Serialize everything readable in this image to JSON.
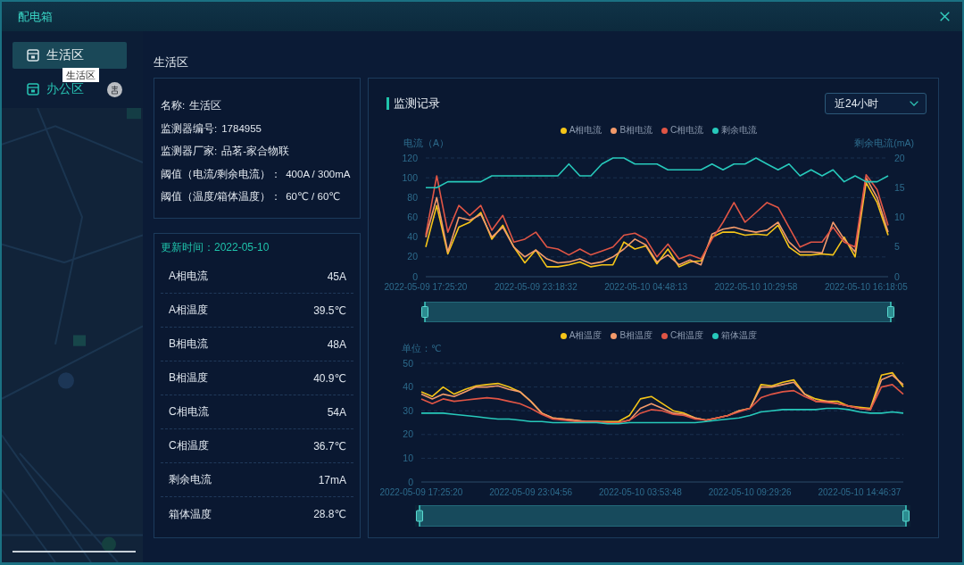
{
  "window": {
    "title": "配电箱"
  },
  "sidebar": {
    "items": [
      {
        "label": "生活区",
        "selected": true,
        "badge": false
      },
      {
        "label": "办公区",
        "selected": false,
        "badge": true
      }
    ],
    "tooltip": "生活区"
  },
  "heading": "生活区",
  "info": [
    {
      "label": "名称:",
      "value": "生活区"
    },
    {
      "label": "监测器编号:",
      "value": "1784955"
    },
    {
      "label": "监测器厂家:",
      "value": "品茗-家合物联"
    },
    {
      "label": "阈值（电流/剩余电流）：",
      "value": "400A / 300mA"
    },
    {
      "label": "阈值（温度/箱体温度）：",
      "value": "60℃ / 60℃"
    }
  ],
  "readings": {
    "updated": "更新时间：2022-05-10",
    "rows": [
      {
        "label": "A相电流",
        "value": "45A"
      },
      {
        "label": "A相温度",
        "value": "39.5℃"
      },
      {
        "label": "B相电流",
        "value": "48A"
      },
      {
        "label": "B相温度",
        "value": "40.9℃"
      },
      {
        "label": "C相电流",
        "value": "54A"
      },
      {
        "label": "C相温度",
        "value": "36.7℃"
      },
      {
        "label": "剩余电流",
        "value": "17mA"
      },
      {
        "label": "箱体温度",
        "value": "28.8℃"
      }
    ]
  },
  "monitor": {
    "title": "监测记录",
    "range": "近24小时",
    "charts": [
      {
        "chart_data": {
          "type": "line",
          "legend": "top",
          "grid": true,
          "ylabel": "电流（A）",
          "ylim": [
            0,
            120
          ],
          "yticks": [
            0,
            20,
            40,
            60,
            80,
            100,
            120
          ],
          "y2label": "剩余电流(mA)",
          "y2lim": [
            0,
            20
          ],
          "y2ticks": [
            0,
            5,
            10,
            15,
            20
          ],
          "categories": [
            "2022-05-09 17:25:20",
            null,
            null,
            null,
            null,
            null,
            null,
            null,
            null,
            null,
            "2022-05-09 23:18:32",
            null,
            null,
            null,
            null,
            null,
            null,
            null,
            null,
            null,
            "2022-05-10 04:48:13",
            null,
            null,
            null,
            null,
            null,
            null,
            null,
            null,
            null,
            "2022-05-10 10:29:58",
            null,
            null,
            null,
            null,
            null,
            null,
            null,
            null,
            null,
            "2022-05-10 16:18:05",
            null,
            null
          ],
          "series": [
            {
              "name": "A相电流",
              "color": "#f5c518",
              "values": [
                30,
                72,
                23,
                50,
                55,
                65,
                38,
                52,
                30,
                14,
                27,
                10,
                10,
                12,
                15,
                10,
                12,
                12,
                35,
                28,
                31,
                13,
                28,
                10,
                15,
                16,
                40,
                45,
                45,
                42,
                43,
                42,
                52,
                30,
                22,
                22,
                23,
                22,
                40,
                20,
                95,
                75,
                42
              ]
            },
            {
              "name": "B相电流",
              "color": "#f39a6a",
              "values": [
                40,
                80,
                25,
                60,
                57,
                63,
                40,
                50,
                30,
                20,
                27,
                18,
                14,
                15,
                18,
                13,
                15,
                20,
                28,
                38,
                32,
                15,
                22,
                12,
                17,
                12,
                43,
                48,
                50,
                47,
                45,
                47,
                55,
                35,
                25,
                25,
                24,
                55,
                38,
                25,
                100,
                80,
                45
              ]
            },
            {
              "name": "C相电流",
              "color": "#e05545",
              "values": [
                42,
                102,
                45,
                72,
                62,
                72,
                47,
                62,
                35,
                38,
                45,
                30,
                28,
                22,
                28,
                22,
                26,
                30,
                42,
                44,
                38,
                20,
                33,
                18,
                22,
                18,
                38,
                55,
                75,
                55,
                65,
                75,
                70,
                50,
                30,
                35,
                35,
                50,
                35,
                30,
                103,
                88,
                52
              ]
            },
            {
              "name": "剩余电流",
              "color": "#27c9bb",
              "axis": "y2",
              "values": [
                15,
                15,
                16,
                16,
                16,
                16,
                17,
                17,
                17,
                17,
                17,
                17,
                17,
                19,
                17,
                17,
                19,
                20,
                20,
                19,
                19,
                19,
                18,
                18,
                18,
                18,
                19,
                18,
                19,
                19,
                20,
                19,
                18,
                19,
                17,
                18,
                17,
                18,
                16,
                17,
                16,
                16,
                17
              ]
            }
          ]
        },
        "zoom": {
          "level": 1
        }
      },
      {
        "chart_data": {
          "type": "line",
          "legend": "top",
          "grid": true,
          "ylabel": "单位：℃",
          "ylim": [
            0,
            50
          ],
          "yticks": [
            0,
            10,
            20,
            30,
            40,
            50
          ],
          "categories": [
            "2022-05-09 17:25:20",
            null,
            null,
            null,
            null,
            null,
            null,
            null,
            null,
            null,
            "2022-05-09 23:04:56",
            null,
            null,
            null,
            null,
            null,
            null,
            null,
            null,
            null,
            "2022-05-10 03:53:48",
            null,
            null,
            null,
            null,
            null,
            null,
            null,
            null,
            null,
            "2022-05-10 09:29:26",
            null,
            null,
            null,
            null,
            null,
            null,
            null,
            null,
            null,
            "2022-05-10 14:46:37",
            null,
            null,
            null,
            null
          ],
          "series": [
            {
              "name": "A相温度",
              "color": "#f5c518",
              "values": [
                38,
                36,
                40,
                37,
                39,
                40.5,
                41,
                41.5,
                40,
                38,
                34,
                29,
                27,
                26.5,
                26,
                25.5,
                25.5,
                25.5,
                25.5,
                28,
                35,
                36,
                33,
                30,
                29,
                27,
                26,
                27,
                28,
                30,
                31,
                41,
                40.5,
                42,
                43,
                37,
                35,
                34,
                34,
                32,
                31.5,
                31,
                45,
                46,
                40
              ]
            },
            {
              "name": "B相温度",
              "color": "#f39a6a",
              "values": [
                37,
                35,
                37,
                36,
                38,
                40,
                40,
                40.5,
                39,
                38,
                34,
                29,
                27,
                26.5,
                26,
                25.5,
                25.5,
                25,
                25,
                26,
                31,
                33,
                31,
                29,
                28.5,
                27,
                26,
                27,
                28,
                30,
                31,
                40,
                40,
                41,
                42,
                37,
                34,
                34,
                33,
                32,
                31,
                30.5,
                43,
                45,
                41
              ]
            },
            {
              "name": "C相温度",
              "color": "#e05545",
              "values": [
                35,
                33,
                35,
                34,
                34.5,
                35,
                35.5,
                35,
                34,
                33,
                31,
                28.5,
                26.5,
                26,
                25.5,
                25.5,
                25.5,
                25,
                25,
                26,
                29,
                30.5,
                30,
                28.5,
                28,
                26.5,
                26,
                27,
                28,
                29.5,
                31,
                35.5,
                37,
                38,
                38.5,
                36,
                34,
                33.5,
                33,
                32,
                31,
                30.5,
                40,
                41,
                37
              ]
            },
            {
              "name": "箱体温度",
              "color": "#27c9bb",
              "values": [
                29,
                29,
                29,
                28.5,
                28,
                27.5,
                27,
                26.5,
                26.5,
                26,
                25.5,
                25.5,
                25,
                25,
                25,
                25,
                25,
                24.5,
                24.5,
                25,
                25,
                25,
                25,
                25,
                25,
                25,
                25.5,
                26,
                26.5,
                27,
                28,
                29.5,
                30,
                30.5,
                30.5,
                30.5,
                30.5,
                31,
                31,
                30.5,
                29.5,
                29,
                29,
                29.5,
                29
              ]
            }
          ]
        },
        "zoom": {
          "level": 1
        }
      }
    ]
  }
}
